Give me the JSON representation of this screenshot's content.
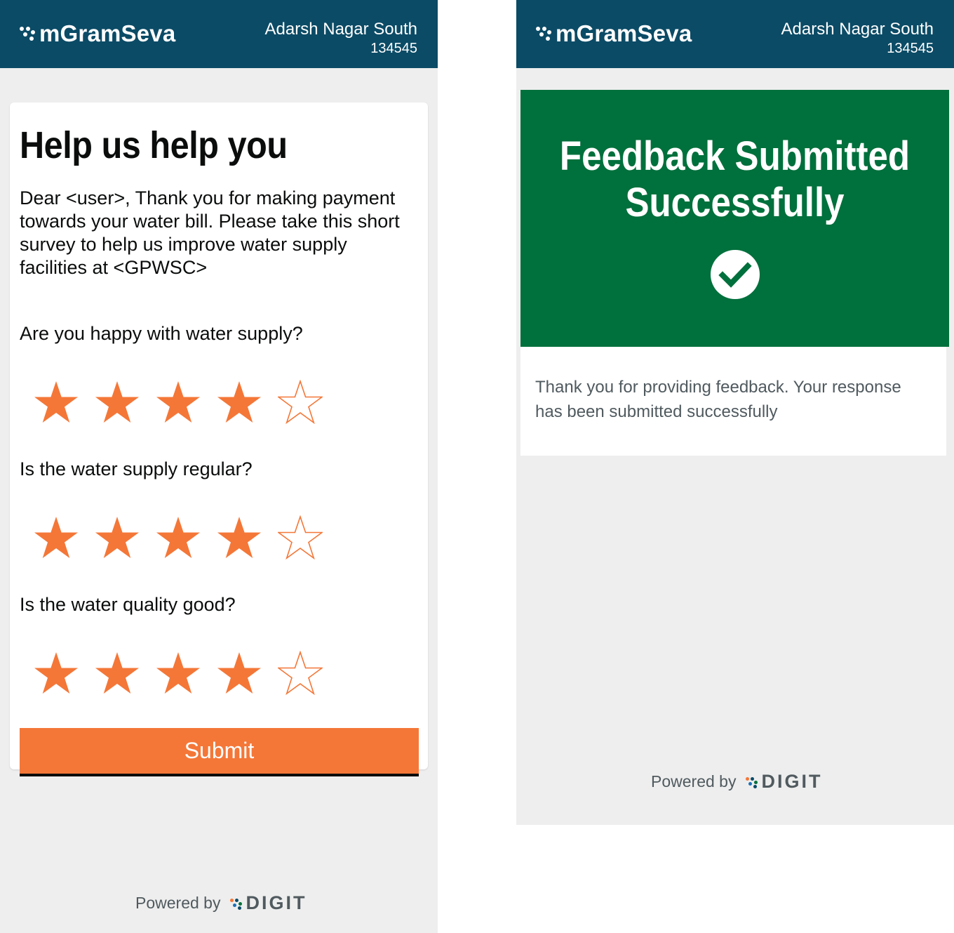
{
  "header": {
    "app_name": "mGramSeva",
    "location_name": "Adarsh Nagar South",
    "location_code": "134545"
  },
  "survey": {
    "title": "Help us help you",
    "intro": "Dear <user>, Thank you for making payment towards your water bill. Please take this short survey to help us improve water supply facilities at <GPWSC>",
    "questions": [
      {
        "label": "Are you happy with water supply?",
        "rating": 4,
        "max": 5
      },
      {
        "label": "Is the water supply regular?",
        "rating": 4,
        "max": 5
      },
      {
        "label": "Is the water quality good?",
        "rating": 4,
        "max": 5
      }
    ],
    "submit_label": "Submit"
  },
  "success": {
    "title_line1": "Feedback Submitted",
    "title_line2": "Successfully",
    "message": "Thank you for providing feedback. Your response has been submitted successfully"
  },
  "footer": {
    "powered_by": "Powered by",
    "brand": "DIGIT"
  },
  "colors": {
    "header_bg": "#0b4b66",
    "accent_orange": "#f47738",
    "success_green": "#00703c",
    "page_bg": "#eeeeee"
  },
  "icons": {
    "brand_logo": "mgramseva-dots-icon",
    "star_filled": "star-filled-icon",
    "star_empty": "star-outline-icon",
    "success": "check-circle-icon",
    "digit_logo": "digit-dots-icon"
  }
}
